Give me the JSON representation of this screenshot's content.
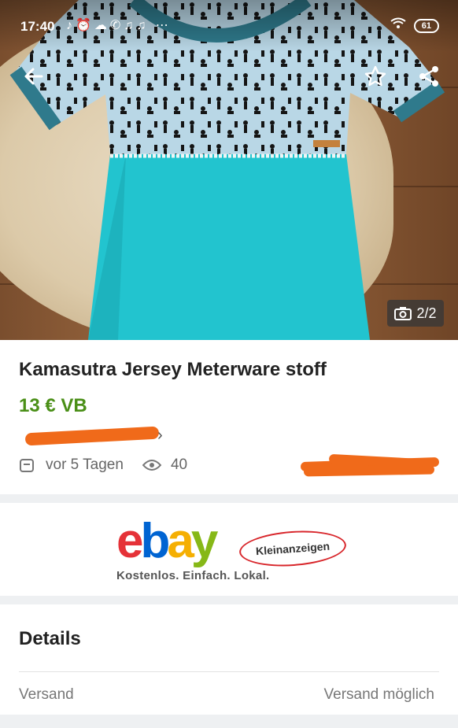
{
  "status_bar": {
    "time": "17:40",
    "notification_icons": "♪⏰☁✆♫♫ ⋯",
    "battery": "61"
  },
  "gallery": {
    "counter": "2/2"
  },
  "listing": {
    "title": "Kamasutra Jersey Meterware stoff",
    "price": "13 € VB",
    "posted": "vor 5 Tagen",
    "views": "40"
  },
  "banner": {
    "badge": "Kleinanzeigen",
    "tagline": "Kostenlos. Einfach. Lokal."
  },
  "details": {
    "heading": "Details",
    "rows": [
      {
        "label": "Versand",
        "value": "Versand möglich"
      }
    ]
  },
  "colors": {
    "price_green": "#4a8f17",
    "redaction_orange": "#f06a1a",
    "shirt_teal": "#22c4cf",
    "shirt_top": "#b9d7e6"
  }
}
